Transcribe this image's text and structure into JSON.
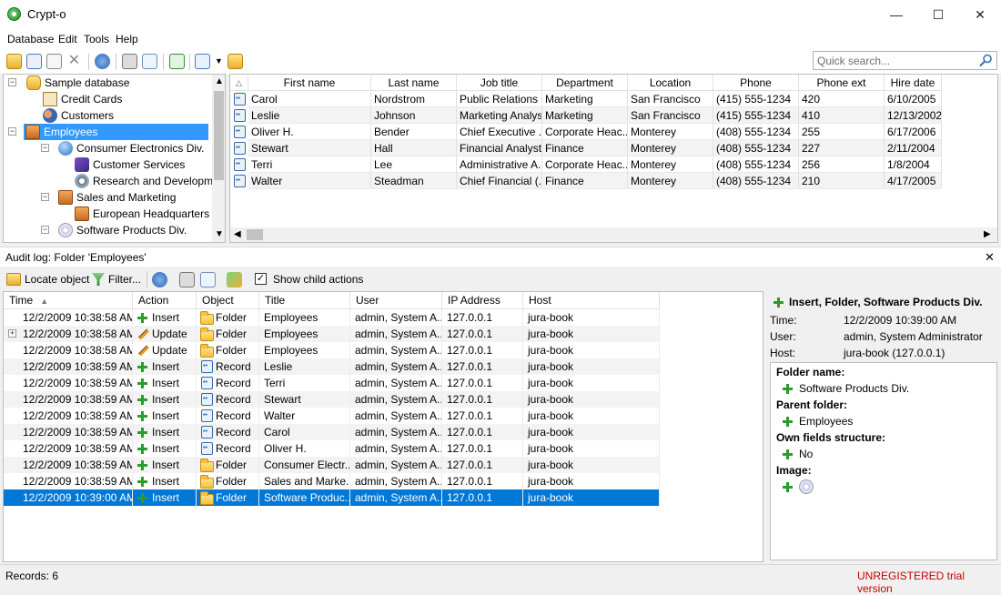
{
  "window": {
    "title": "Crypt-o",
    "minimize": "—",
    "maximize": "☐",
    "close": "✕"
  },
  "menu": [
    "Database",
    "Edit",
    "Tools",
    "Help"
  ],
  "search": {
    "placeholder": "Quick search..."
  },
  "tree": {
    "items": [
      {
        "label": "Sample database",
        "icon": "database-icon"
      },
      {
        "label": "Credit Cards",
        "icon": "credit-card-icon"
      },
      {
        "label": "Customers",
        "icon": "users-icon"
      },
      {
        "label": "Employees",
        "icon": "briefcase-icon"
      },
      {
        "label": "Consumer Electronics Div.",
        "icon": "globe-icon"
      },
      {
        "label": "Customer Services",
        "icon": "phone-icon"
      },
      {
        "label": "Research and Developmen",
        "icon": "gear-icon"
      },
      {
        "label": "Sales and Marketing",
        "icon": "briefcase-icon"
      },
      {
        "label": "European Headquarters",
        "icon": "briefcase-icon"
      },
      {
        "label": "Software Products Div.",
        "icon": "cd-icon"
      }
    ]
  },
  "grid": {
    "columns": [
      "First name",
      "Last name",
      "Job title",
      "Department",
      "Location",
      "Phone",
      "Phone ext",
      "Hire date"
    ],
    "rows": [
      [
        "Carol",
        "Nordstrom",
        "Public Relations ...",
        "Marketing",
        "San Francisco",
        "(415) 555-1234",
        "420",
        "6/10/2005"
      ],
      [
        "Leslie",
        "Johnson",
        "Marketing Analyst",
        "Marketing",
        "San Francisco",
        "(415) 555-1234",
        "410",
        "12/13/2002"
      ],
      [
        "Oliver H.",
        "Bender",
        "Chief Executive ...",
        "Corporate Heac...",
        "Monterey",
        "(408) 555-1234",
        "255",
        "6/17/2006"
      ],
      [
        "Stewart",
        "Hall",
        "Financial Analyst",
        "Finance",
        "Monterey",
        "(408) 555-1234",
        "227",
        "2/11/2004"
      ],
      [
        "Terri",
        "Lee",
        "Administrative A...",
        "Corporate Heac...",
        "Monterey",
        "(408) 555-1234",
        "256",
        "1/8/2004"
      ],
      [
        "Walter",
        "Steadman",
        "Chief Financial (...",
        "Finance",
        "Monterey",
        "(408) 555-1234",
        "210",
        "4/17/2005"
      ]
    ]
  },
  "audit": {
    "title": "Audit log: Folder 'Employees'",
    "toolbar": {
      "locate": "Locate object",
      "filter": "Filter...",
      "show_child": "Show child actions"
    },
    "columns": [
      "Time",
      "Action",
      "Object",
      "Title",
      "User",
      "IP Address",
      "Host"
    ],
    "rows": [
      [
        "12/2/2009 10:38:58 AM",
        "Insert",
        "Folder",
        "Employees",
        "admin, System A...",
        "127.0.0.1",
        "jura-book"
      ],
      [
        "12/2/2009 10:38:58 AM",
        "Update",
        "Folder",
        "Employees",
        "admin, System A...",
        "127.0.0.1",
        "jura-book"
      ],
      [
        "12/2/2009 10:38:58 AM",
        "Update",
        "Folder",
        "Employees",
        "admin, System A...",
        "127.0.0.1",
        "jura-book"
      ],
      [
        "12/2/2009 10:38:59 AM",
        "Insert",
        "Record",
        "Leslie",
        "admin, System A...",
        "127.0.0.1",
        "jura-book"
      ],
      [
        "12/2/2009 10:38:59 AM",
        "Insert",
        "Record",
        "Terri",
        "admin, System A...",
        "127.0.0.1",
        "jura-book"
      ],
      [
        "12/2/2009 10:38:59 AM",
        "Insert",
        "Record",
        "Stewart",
        "admin, System A...",
        "127.0.0.1",
        "jura-book"
      ],
      [
        "12/2/2009 10:38:59 AM",
        "Insert",
        "Record",
        "Walter",
        "admin, System A...",
        "127.0.0.1",
        "jura-book"
      ],
      [
        "12/2/2009 10:38:59 AM",
        "Insert",
        "Record",
        "Carol",
        "admin, System A...",
        "127.0.0.1",
        "jura-book"
      ],
      [
        "12/2/2009 10:38:59 AM",
        "Insert",
        "Record",
        "Oliver H.",
        "admin, System A...",
        "127.0.0.1",
        "jura-book"
      ],
      [
        "12/2/2009 10:38:59 AM",
        "Insert",
        "Folder",
        "Consumer Electr...",
        "admin, System A...",
        "127.0.0.1",
        "jura-book"
      ],
      [
        "12/2/2009 10:38:59 AM",
        "Insert",
        "Folder",
        "Sales and Marke...",
        "admin, System A...",
        "127.0.0.1",
        "jura-book"
      ],
      [
        "12/2/2009 10:39:00 AM",
        "Insert",
        "Folder",
        "Software Produc...",
        "admin, System A...",
        "127.0.0.1",
        "jura-book"
      ]
    ]
  },
  "detail": {
    "heading": "Insert, Folder, Software Products Div.",
    "time_label": "Time:",
    "time_value": "12/2/2009 10:39:00 AM",
    "user_label": "User:",
    "user_value": "admin, System Administrator",
    "host_label": "Host:",
    "host_value": "jura-book (127.0.0.1)",
    "folder_name_label": "Folder name:",
    "folder_name_value": "Software Products Div.",
    "parent_label": "Parent folder:",
    "parent_value": "Employees",
    "own_fields_label": "Own fields structure:",
    "own_fields_value": "No",
    "image_label": "Image:"
  },
  "status": {
    "records": "Records: 6",
    "trial": "UNREGISTERED trial version"
  },
  "colors": {
    "selection": "#0078d7",
    "tree_selection": "#3399ff",
    "trial_text": "#cc0000",
    "insert_green": "#2d9b2d"
  }
}
